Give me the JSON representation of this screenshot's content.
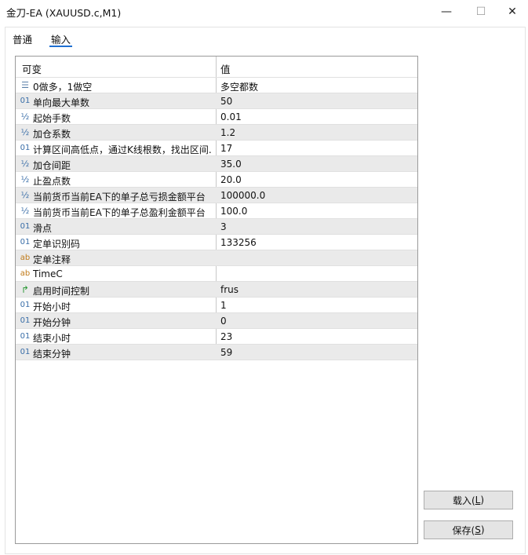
{
  "window": {
    "title": "金刀-EA (XAUUSD.c,M1)",
    "minimize_glyph": "—",
    "maximize_glyph": "☐",
    "close_glyph": "✕"
  },
  "tabs": [
    {
      "label": "普通",
      "active": false
    },
    {
      "label": "输入",
      "active": true
    }
  ],
  "grid": {
    "header": {
      "variable": "可变",
      "value": "值"
    },
    "rows": [
      {
        "icon": "enum-icon",
        "glyph": "☰",
        "name": "0做多，1做空",
        "value": "多空都数"
      },
      {
        "icon": "int-icon",
        "glyph": "01",
        "name": "单向最大单数",
        "value": "50"
      },
      {
        "icon": "double-icon",
        "glyph": "½",
        "name": "起始手数",
        "value": "0.01"
      },
      {
        "icon": "double-icon",
        "glyph": "½",
        "name": "加仓系数",
        "value": "1.2"
      },
      {
        "icon": "int-icon",
        "glyph": "01",
        "name": "计算区间高低点，通过K线根数，找出区间...",
        "value": "17"
      },
      {
        "icon": "double-icon",
        "glyph": "½",
        "name": "加仓间距",
        "value": "35.0"
      },
      {
        "icon": "double-icon",
        "glyph": "½",
        "name": "止盈点数",
        "value": "20.0"
      },
      {
        "icon": "double-icon",
        "glyph": "½",
        "name": "当前货币当前EA下的单子总亏损金额平台",
        "value": "100000.0"
      },
      {
        "icon": "double-icon",
        "glyph": "½",
        "name": "当前货币当前EA下的单子总盈利金额平台",
        "value": "100.0"
      },
      {
        "icon": "int-icon",
        "glyph": "01",
        "name": "滑点",
        "value": "3"
      },
      {
        "icon": "int-icon",
        "glyph": "01",
        "name": "定单识别码",
        "value": "133256"
      },
      {
        "icon": "string-icon",
        "glyph": "ab",
        "name": "定单注释",
        "value": ""
      },
      {
        "icon": "string-icon",
        "glyph": "ab",
        "name": "TimeC",
        "value": ""
      },
      {
        "icon": "bool-icon",
        "glyph": "↱",
        "name": "启用时间控制",
        "value": "frus"
      },
      {
        "icon": "int-icon",
        "glyph": "01",
        "name": "开始小时",
        "value": "1"
      },
      {
        "icon": "int-icon",
        "glyph": "01",
        "name": "开始分钟",
        "value": "0"
      },
      {
        "icon": "int-icon",
        "glyph": "01",
        "name": "结束小时",
        "value": "23"
      },
      {
        "icon": "int-icon",
        "glyph": "01",
        "name": "结束分钟",
        "value": "59"
      }
    ]
  },
  "buttons": {
    "load_prefix": "载入(",
    "load_key": "L",
    "load_suffix": ")",
    "save_prefix": "保存(",
    "save_key": "S",
    "save_suffix": ")"
  }
}
